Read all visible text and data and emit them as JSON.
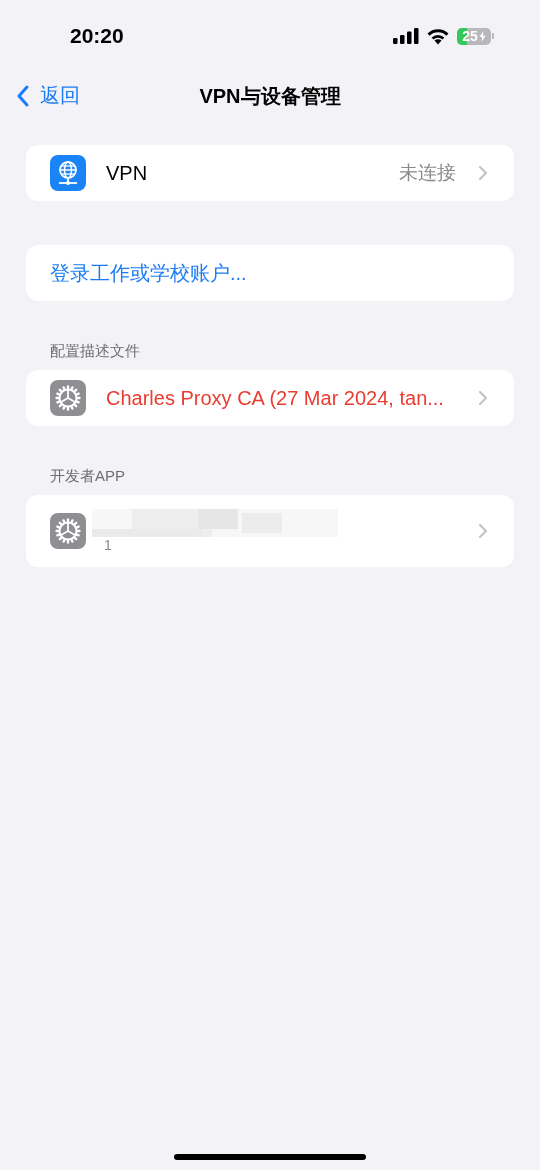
{
  "status_bar": {
    "time": "20:20",
    "battery": "25"
  },
  "nav": {
    "back": "返回",
    "title": "VPN与设备管理"
  },
  "sections": [
    {
      "rows": [
        {
          "kind": "vpn",
          "label": "VPN",
          "value": "未连接"
        }
      ]
    },
    {
      "rows": [
        {
          "kind": "action",
          "label": "登录工作或学校账户..."
        }
      ]
    },
    {
      "header": "配置描述文件",
      "rows": [
        {
          "kind": "profile",
          "label": "Charles Proxy CA (27 Mar 2024, tan...",
          "warning": true
        }
      ]
    },
    {
      "header": "开发者APP",
      "rows": [
        {
          "kind": "developer_app",
          "subtitle": "1"
        }
      ]
    }
  ]
}
